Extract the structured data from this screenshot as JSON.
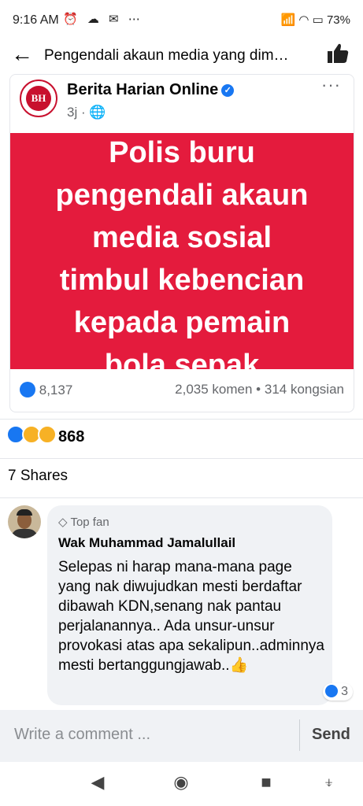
{
  "status": {
    "time": "9:16 AM",
    "battery": "73%"
  },
  "header": {
    "back_icon": "arrow-left-icon",
    "title": "Pengendali akaun media yang dim…"
  },
  "post": {
    "page_name": "Berita Harian Online",
    "logo_text": "BH",
    "time": "3j",
    "image_headline": [
      "Polis buru",
      "pengendali akaun",
      "media sosial",
      "timbul kebencian",
      "kepada pemain",
      "bola sepak"
    ],
    "likes": "8,137",
    "comments_shares": "2,035 komen • 314 kongsian",
    "brand_color": "#e41b3d"
  },
  "reactions": {
    "count": "868"
  },
  "shares": "7 Shares",
  "comment": {
    "badge": "Top fan",
    "author": "Wak Muhammad Jamalullail",
    "text": "Selepas ni harap mana-mana page yang nak diwujudkan mesti berdaftar dibawah KDN,senang nak pantau perjalanannya.. Ada unsur-unsur provokasi atas apa sekalipun..adminnya mesti bertanggungjawab..",
    "thumb": "👍",
    "reaction_count": "3"
  },
  "composer": {
    "placeholder": "Write a comment ...",
    "send_label": "Send"
  }
}
